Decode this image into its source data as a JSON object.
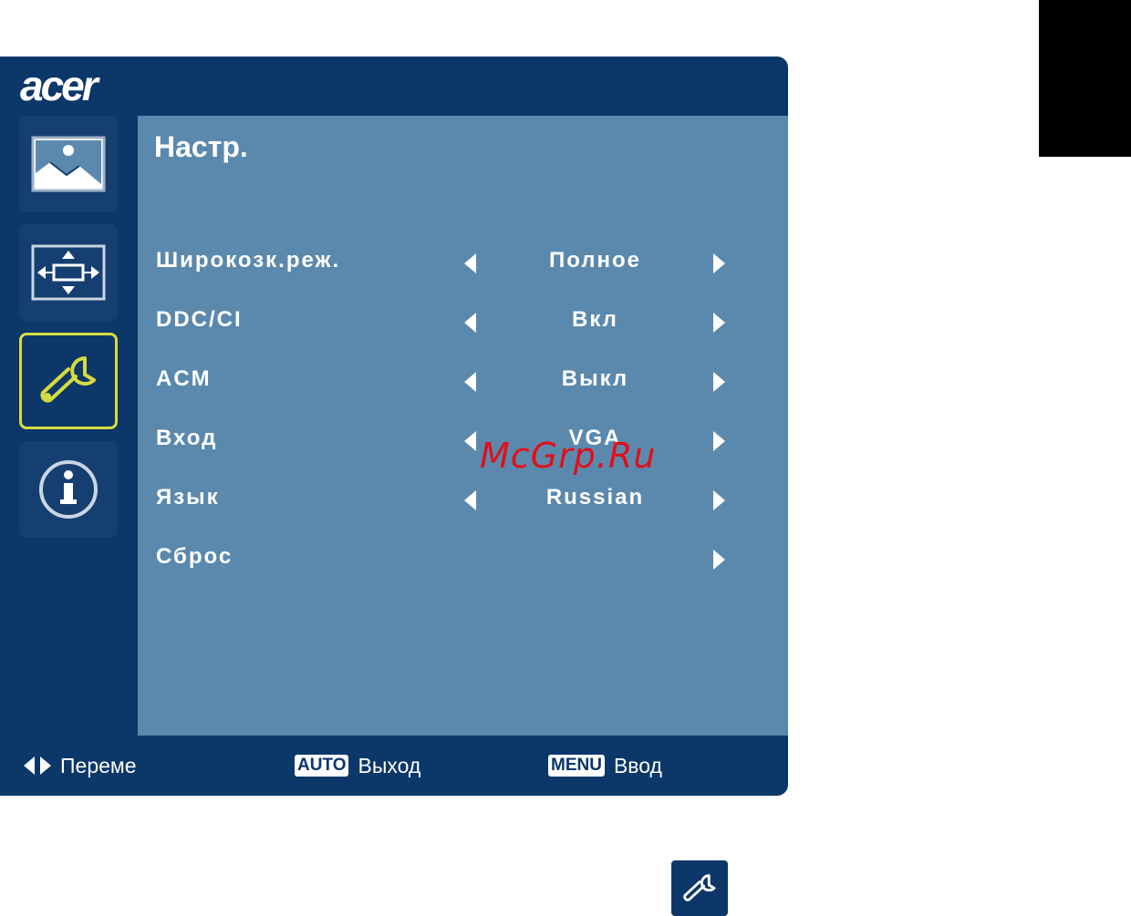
{
  "brand": {
    "logo": "acer"
  },
  "panel": {
    "title": "Настр."
  },
  "sidebar": {
    "items": [
      {
        "icon": "picture-icon",
        "selected": false
      },
      {
        "icon": "position-icon",
        "selected": false
      },
      {
        "icon": "wrench-icon",
        "selected": true
      },
      {
        "icon": "info-icon",
        "selected": false
      }
    ]
  },
  "rows": [
    {
      "label": "Широкозк.реж.",
      "value": "Полное",
      "has_left_arrow": true,
      "has_right_arrow": true
    },
    {
      "label": "DDC/CI",
      "value": "Вкл",
      "has_left_arrow": true,
      "has_right_arrow": true
    },
    {
      "label": "ACM",
      "value": "Выкл",
      "has_left_arrow": true,
      "has_right_arrow": true
    },
    {
      "label": "Вход",
      "value": "VGA",
      "has_left_arrow": true,
      "has_right_arrow": true
    },
    {
      "label": "Язык",
      "value": "Russian",
      "has_left_arrow": true,
      "has_right_arrow": true
    },
    {
      "label": "Сброс",
      "value": "",
      "has_left_arrow": false,
      "has_right_arrow": true
    }
  ],
  "footer": {
    "move_label": "Переме",
    "auto_key": "AUTO",
    "auto_label": "Выход",
    "menu_key": "MENU",
    "menu_label": "Ввод"
  },
  "watermark": "McGrp.Ru",
  "colors": {
    "osd_background": "#0b3769",
    "content_background": "#5b89ad",
    "selected_border": "#d6dc3e",
    "watermark": "#e0101a"
  }
}
